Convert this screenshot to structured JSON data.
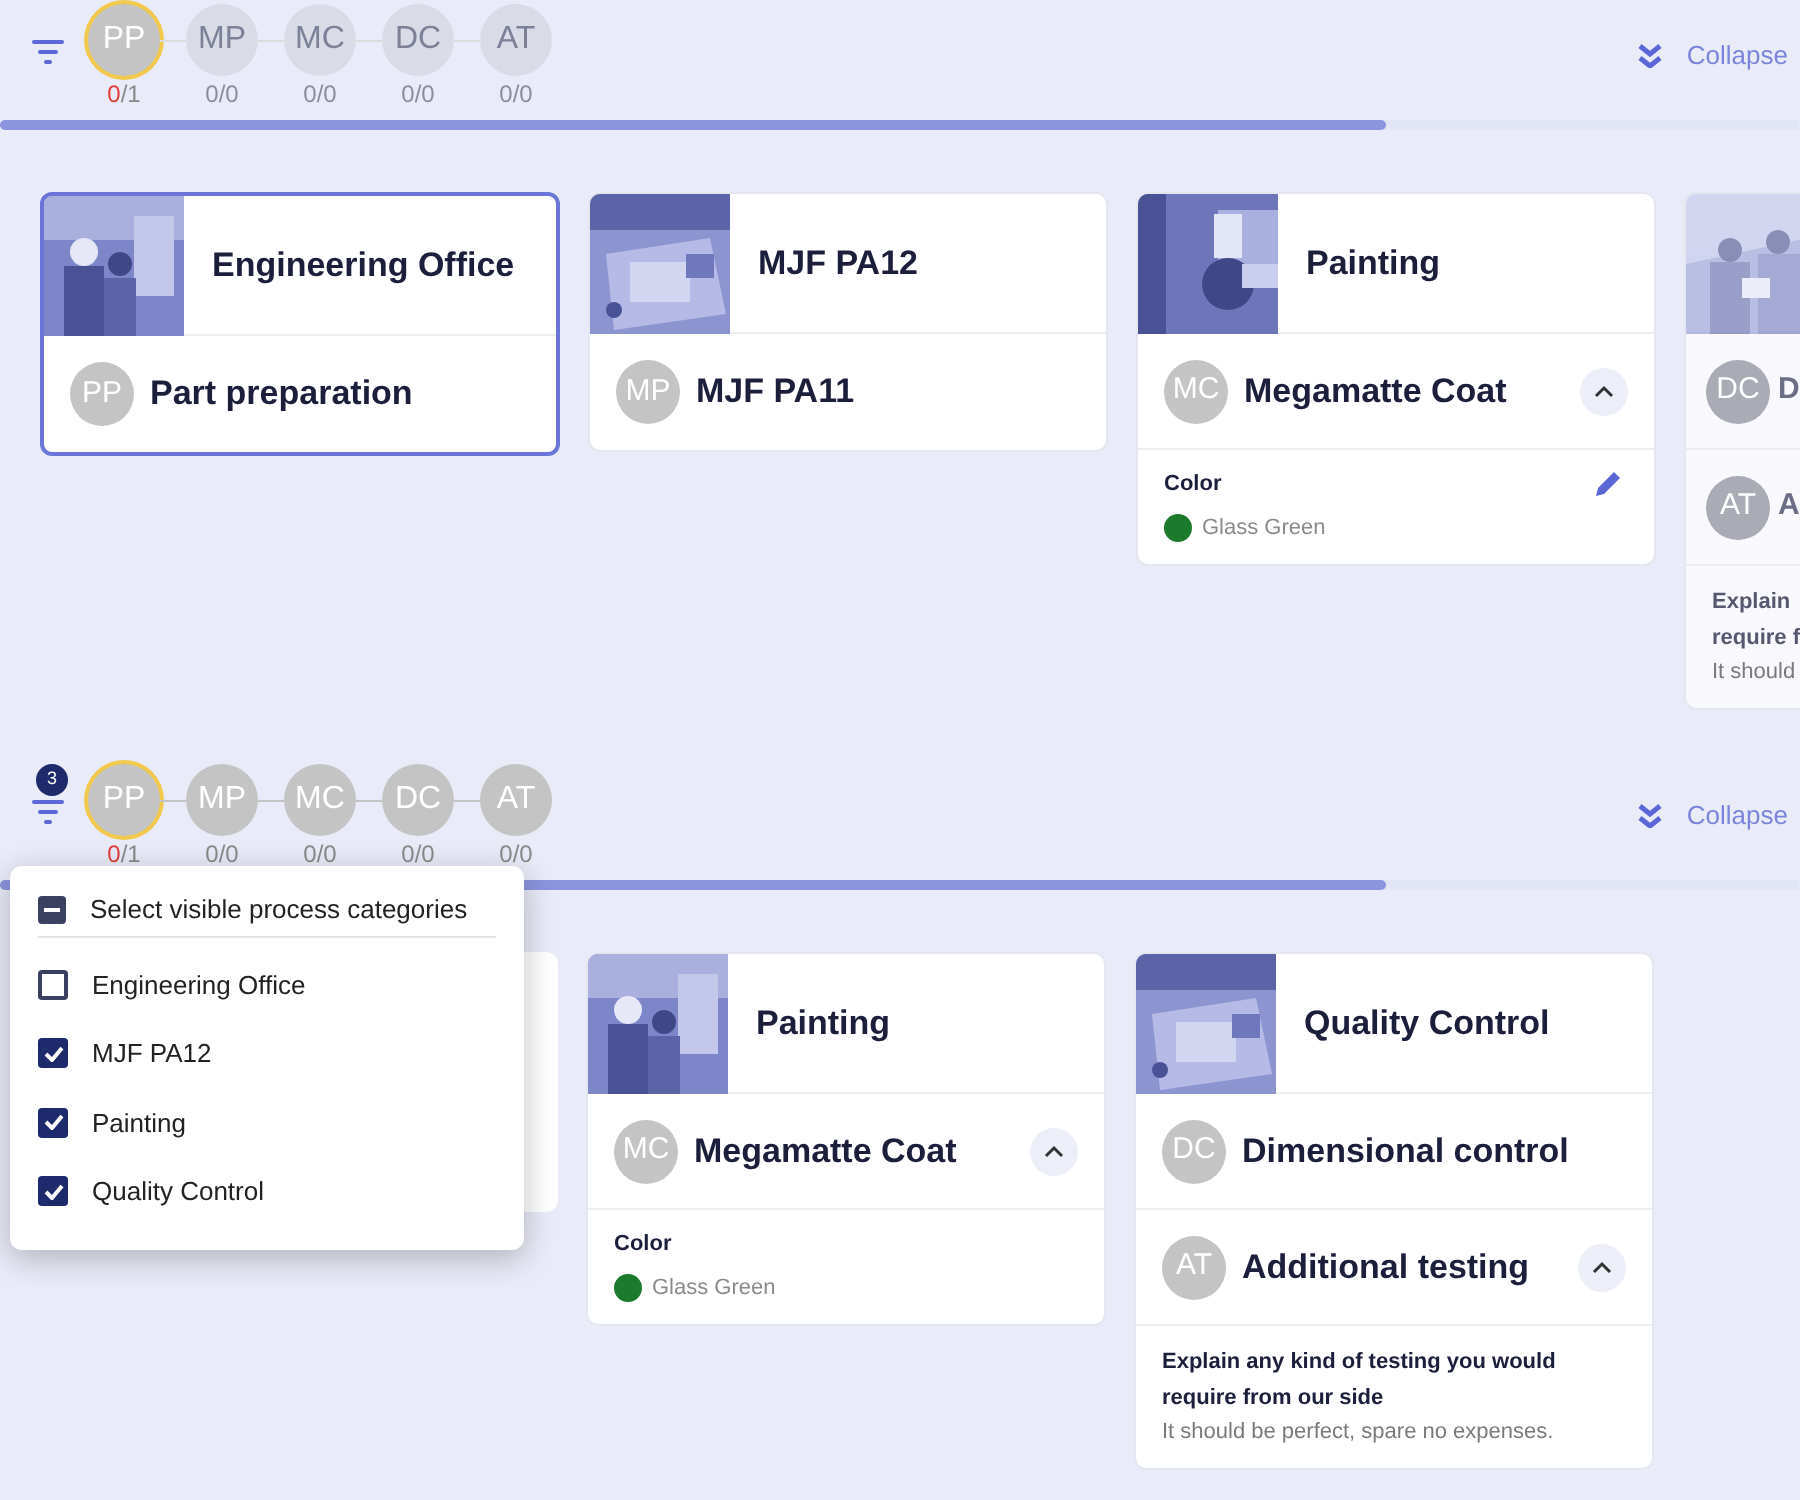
{
  "panels": [
    {
      "collapse": "Collapse",
      "progress": {
        "level": 0.77
      },
      "steps": [
        {
          "initials": "PP",
          "done": "0",
          "total": "/1",
          "current": true,
          "dimmed": false,
          "incomplete": true
        },
        {
          "initials": "MP",
          "done": "0",
          "total": "/0",
          "current": false,
          "dimmed": true,
          "incomplete": false
        },
        {
          "initials": "MC",
          "done": "0",
          "total": "/0",
          "current": false,
          "dimmed": true,
          "incomplete": false
        },
        {
          "initials": "DC",
          "done": "0",
          "total": "/0",
          "current": false,
          "dimmed": true,
          "incomplete": false
        },
        {
          "initials": "AT",
          "done": "0",
          "total": "/0",
          "current": false,
          "dimmed": true,
          "incomplete": false
        }
      ],
      "cards": [
        {
          "kind": "card",
          "title": "Engineering Office",
          "selected": true,
          "faded": false,
          "processes": [
            {
              "initials": "PP",
              "name": "Part preparation"
            }
          ]
        },
        {
          "kind": "card",
          "title": "MJF PA12",
          "selected": false,
          "faded": false,
          "processes": [
            {
              "initials": "MP",
              "name": "MJF PA11"
            }
          ]
        },
        {
          "kind": "card",
          "title": "Painting",
          "selected": false,
          "faded": false,
          "processes": [
            {
              "initials": "MC",
              "name": "Megamatte Coat",
              "expanded": true,
              "toggle": true,
              "details": {
                "kind": "color",
                "label": "Color",
                "value": "Glass Green",
                "color": "#1b7a2b",
                "editable": true
              }
            }
          ]
        },
        {
          "kind": "card",
          "selected": false,
          "faded": true,
          "processes": [
            {
              "initials": "DC",
              "name": "D"
            },
            {
              "initials": "AT",
              "name": "A",
              "expanded": true,
              "details": {
                "kind": "note",
                "question_lines": [
                  "Explain",
                  "require f"
                ],
                "answer": "It should"
              }
            }
          ]
        }
      ]
    },
    {
      "filter": {
        "badge": "3"
      },
      "collapse": "Collapse",
      "progress": {
        "level": 0.77
      },
      "steps": [
        {
          "initials": "PP",
          "done": "0",
          "total": "/1",
          "current": true,
          "dimmed": false,
          "incomplete": true
        },
        {
          "initials": "MP",
          "done": "0",
          "total": "/0",
          "current": false,
          "dimmed": false,
          "incomplete": false
        },
        {
          "initials": "MC",
          "done": "0",
          "total": "/0",
          "current": false,
          "dimmed": false,
          "incomplete": false
        },
        {
          "initials": "DC",
          "done": "0",
          "total": "/0",
          "current": false,
          "dimmed": false,
          "incomplete": false
        },
        {
          "initials": "AT",
          "done": "0",
          "total": "/0",
          "current": false,
          "dimmed": false,
          "incomplete": false
        }
      ],
      "menu": {
        "header": "Select visible process categories",
        "header_partial": true,
        "items": [
          {
            "label": "Engineering Office",
            "checked": false
          },
          {
            "label": "MJF PA12",
            "checked": true
          },
          {
            "label": "Painting",
            "checked": true
          },
          {
            "label": "Quality Control",
            "checked": true
          }
        ]
      },
      "cards": [
        {
          "kind": "covered"
        },
        {
          "kind": "card",
          "title": "Painting",
          "selected": false,
          "faded": false,
          "processes": [
            {
              "initials": "MC",
              "name": "Megamatte Coat",
              "expanded": true,
              "toggle": true,
              "details": {
                "kind": "color",
                "label": "Color",
                "value": "Glass Green",
                "color": "#1b7a2b",
                "editable": false
              }
            }
          ]
        },
        {
          "kind": "card",
          "title": "Quality Control",
          "selected": false,
          "faded": false,
          "processes": [
            {
              "initials": "DC",
              "name": "Dimensional control"
            },
            {
              "initials": "AT",
              "name": "Additional testing",
              "expanded": true,
              "toggle": true,
              "details": {
                "kind": "note",
                "question_lines": [
                  "Explain any kind of testing you would",
                  "require from our side"
                ],
                "answer": "It should be perfect, spare no expenses."
              }
            }
          ]
        }
      ]
    }
  ]
}
